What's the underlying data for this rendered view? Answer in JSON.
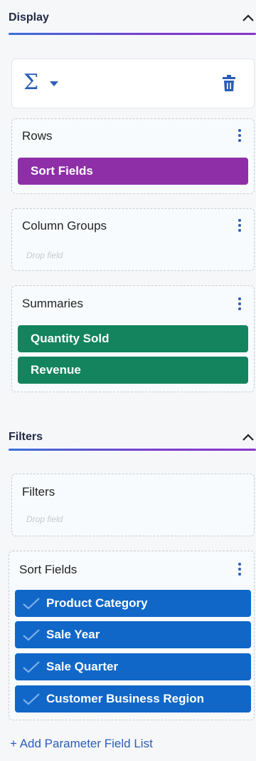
{
  "display": {
    "title": "Display",
    "toolbar": {
      "sigma_icon": "Σ"
    },
    "rows": {
      "label": "Rows",
      "fields": [
        "Sort Fields"
      ]
    },
    "column_groups": {
      "label": "Column Groups",
      "placeholder": "Drop field"
    },
    "summaries": {
      "label": "Summaries",
      "fields": [
        "Quantity Sold",
        "Revenue"
      ]
    }
  },
  "filters": {
    "title": "Filters",
    "filters_box": {
      "label": "Filters",
      "placeholder": "Drop field"
    },
    "sort_fields": {
      "label": "Sort Fields",
      "fields": [
        "Product Category",
        "Sale Year",
        "Sale Quarter",
        "Customer Business Region"
      ]
    }
  },
  "add_parameter_link": "+ Add Parameter Field List",
  "colors": {
    "accent_blue": "#2b5db8",
    "rows_pill": "#8e2fa8",
    "summary_pill": "#13845d",
    "sort_pill": "#1067c8"
  }
}
